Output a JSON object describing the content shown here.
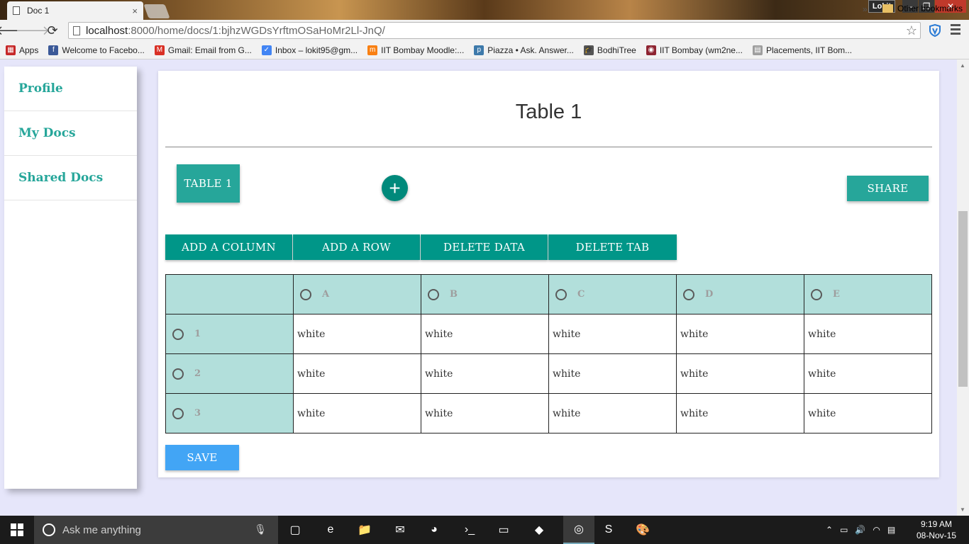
{
  "browser": {
    "tab_title": "Doc 1",
    "tab_close": "×",
    "user": "Lokit",
    "window_controls": {
      "minimize": "–",
      "maximize": "❐",
      "close": "✕"
    },
    "nav": {
      "back": "🡐",
      "forward": "🡒",
      "reload": "⟳"
    },
    "url_host": "localhost",
    "url_path": ":8000/home/docs/1:bjhzWGDsYrftmOSaHoMr2Ll-JnQ/",
    "star": "☆",
    "bookmarks": [
      {
        "label": "Apps",
        "icon": "apps-icon",
        "color": "#c62828",
        "glyph": "▦"
      },
      {
        "label": "Welcome to Facebo...",
        "icon": "facebook-icon",
        "color": "#3b5998",
        "glyph": "f"
      },
      {
        "label": "Gmail: Email from G...",
        "icon": "gmail-icon",
        "color": "#d93025",
        "glyph": "M"
      },
      {
        "label": "Inbox – lokit95@gm...",
        "icon": "inbox-icon",
        "color": "#4285f4",
        "glyph": "✓"
      },
      {
        "label": "IIT Bombay Moodle:...",
        "icon": "moodle-icon",
        "color": "#f98012",
        "glyph": "m"
      },
      {
        "label": "Piazza • Ask. Answer...",
        "icon": "piazza-icon",
        "color": "#3e7aab",
        "glyph": "p"
      },
      {
        "label": "BodhiTree",
        "icon": "bodhitree-icon",
        "color": "#555555",
        "glyph": "🎓"
      },
      {
        "label": "IIT Bombay (wm2ne...",
        "icon": "iitb-icon",
        "color": "#8e2431",
        "glyph": "◉"
      },
      {
        "label": "Placements, IIT Bom...",
        "icon": "placements-icon",
        "color": "#9e9e9e",
        "glyph": "▤"
      }
    ],
    "bookmarks_more": "»",
    "other_bookmarks": "Other bookmarks"
  },
  "sidebar": {
    "items": [
      {
        "label": "Profile"
      },
      {
        "label": "My Docs"
      },
      {
        "label": "Shared Docs"
      }
    ]
  },
  "main": {
    "title": "Table 1",
    "tab_button": "TABLE 1",
    "add_tab_glyph": "+",
    "share_button": "SHARE",
    "actions": {
      "add_column": "ADD A COLUMN",
      "add_row": "ADD A ROW",
      "delete_data": "DELETE DATA",
      "delete_tab": "DELETE TAB"
    },
    "table": {
      "columns": [
        "A",
        "B",
        "C",
        "D",
        "E"
      ],
      "rows": [
        {
          "label": "1",
          "cells": [
            "white",
            "white",
            "white",
            "white",
            "white"
          ]
        },
        {
          "label": "2",
          "cells": [
            "white",
            "white",
            "white",
            "white",
            "white"
          ]
        },
        {
          "label": "3",
          "cells": [
            "white",
            "white",
            "white",
            "white",
            "white"
          ]
        }
      ]
    },
    "save_button": "SAVE"
  },
  "taskbar": {
    "search_placeholder": "Ask me anything",
    "apps": [
      {
        "icon": "task-view-icon",
        "glyph": "▢"
      },
      {
        "icon": "edge-icon",
        "glyph": "e"
      },
      {
        "icon": "file-explorer-icon",
        "glyph": "📁"
      },
      {
        "icon": "mail-icon",
        "glyph": "✉"
      },
      {
        "icon": "app-icon",
        "glyph": "◕"
      },
      {
        "icon": "powershell-icon",
        "glyph": "›_"
      },
      {
        "icon": "terminal-icon",
        "glyph": "▭"
      },
      {
        "icon": "folder-icon",
        "glyph": "◆"
      },
      {
        "icon": "chrome-icon",
        "glyph": "◎"
      },
      {
        "icon": "sublime-icon",
        "glyph": "S"
      },
      {
        "icon": "paint-icon",
        "glyph": "🎨"
      }
    ],
    "time": "9:19 AM",
    "date": "08-Nov-15"
  },
  "colors": {
    "teal": "#26a69a",
    "teal_dark": "#009688",
    "header_cell": "#b2dfdb",
    "save_blue": "#42a5f5",
    "page_bg": "#e6e6fa"
  }
}
